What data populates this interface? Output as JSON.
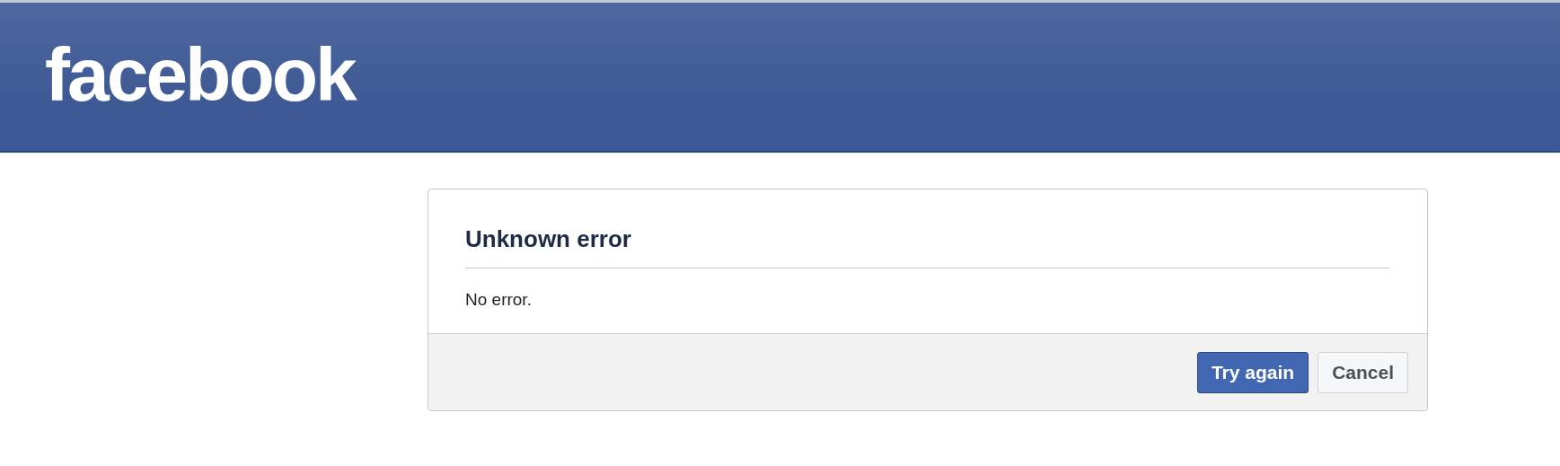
{
  "header": {
    "logo": "facebook"
  },
  "dialog": {
    "title": "Unknown error",
    "message": "No error.",
    "buttons": [
      {
        "label": "Try again",
        "kind": "primary"
      },
      {
        "label": "Cancel",
        "kind": "secondary"
      }
    ]
  }
}
